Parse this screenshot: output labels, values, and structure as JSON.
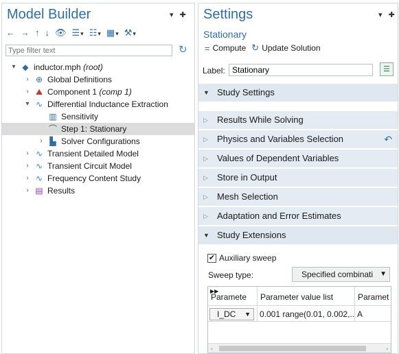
{
  "model_builder": {
    "title": "Model Builder",
    "window_buttons": "▾ ✚",
    "toolbar": [
      {
        "name": "back-icon",
        "glyph": "←"
      },
      {
        "name": "forward-icon",
        "glyph": "→"
      },
      {
        "name": "move-up-icon",
        "glyph": "↑"
      },
      {
        "name": "move-down-icon",
        "glyph": "↓"
      },
      {
        "name": "show-icon",
        "glyph": "👁"
      },
      {
        "name": "collapse-icon",
        "glyph": "☰"
      },
      {
        "name": "expand-icon",
        "glyph": "☷"
      },
      {
        "name": "layout-icon",
        "glyph": "▦"
      },
      {
        "name": "tools-icon",
        "glyph": "⚒"
      }
    ],
    "filter_placeholder": "Type filter text",
    "refresh_glyph": "↻",
    "tree": [
      {
        "label": "inductor.mph",
        "suffix": "(root)",
        "caret": "▾",
        "icon": "◆",
        "icon_color": "#2f6ea5",
        "level": 0
      },
      {
        "label": "Global Definitions",
        "suffix": "",
        "caret": "›",
        "icon": "⊕",
        "icon_color": "#2f6ea5",
        "level": 1
      },
      {
        "label": "Component 1",
        "suffix": "(comp 1)",
        "caret": "›",
        "icon": "⛰",
        "icon_color": "#c0392b",
        "level": 1
      },
      {
        "label": "Differential Inductance Extraction",
        "suffix": "",
        "caret": "▾",
        "icon": "∿",
        "icon_color": "#2f8ac4",
        "level": 1
      },
      {
        "label": "Sensitivity",
        "suffix": "",
        "caret": "",
        "icon": "▥",
        "icon_color": "#2f6ea5",
        "level": 2
      },
      {
        "label": "Step 1: Stationary",
        "suffix": "",
        "caret": "",
        "icon": "⌒",
        "icon_color": "#2a7a40",
        "level": 2,
        "selected": true
      },
      {
        "label": "Solver Configurations",
        "suffix": "",
        "caret": "›",
        "icon": "▙",
        "icon_color": "#2f6ea5",
        "level": 2
      },
      {
        "label": "Transient Detailed Model",
        "suffix": "",
        "caret": "›",
        "icon": "∿",
        "icon_color": "#2f8ac4",
        "level": 1
      },
      {
        "label": "Transient Circuit Model",
        "suffix": "",
        "caret": "›",
        "icon": "∿",
        "icon_color": "#2f8ac4",
        "level": 1
      },
      {
        "label": "Frequency Content Study",
        "suffix": "",
        "caret": "›",
        "icon": "∿",
        "icon_color": "#2f8ac4",
        "level": 1
      },
      {
        "label": "Results",
        "suffix": "",
        "caret": "›",
        "icon": "▤",
        "icon_color": "#8e44ad",
        "level": 1
      }
    ]
  },
  "settings": {
    "title": "Settings",
    "window_buttons": "▾ ✚",
    "subtitle": "Stationary",
    "compute_label": "Compute",
    "update_label": "Update Solution",
    "label_caption": "Label:",
    "label_value": "Stationary",
    "sections_top": [
      {
        "label": "Study Settings",
        "open": true
      }
    ],
    "sections": [
      {
        "label": "Results While Solving",
        "open": false
      },
      {
        "label": "Physics and Variables Selection",
        "open": false,
        "reset": true
      },
      {
        "label": "Values of Dependent Variables",
        "open": false
      },
      {
        "label": "Store in Output",
        "open": false
      },
      {
        "label": "Mesh Selection",
        "open": false
      },
      {
        "label": "Adaptation and Error Estimates",
        "open": false
      },
      {
        "label": "Study Extensions",
        "open": true
      }
    ],
    "auxiliary_sweep_label": "Auxiliary sweep",
    "auxiliary_sweep_checked": true,
    "sweep_type_label": "Sweep type:",
    "sweep_type_value": "Specified combinati",
    "table": {
      "headers": [
        "Paramete",
        "Parameter value list",
        "Paramet"
      ],
      "rows": [
        {
          "param": "I_DC",
          "values": "0.001 range(0.01, 0.002,...",
          "unit": "A"
        }
      ]
    }
  }
}
